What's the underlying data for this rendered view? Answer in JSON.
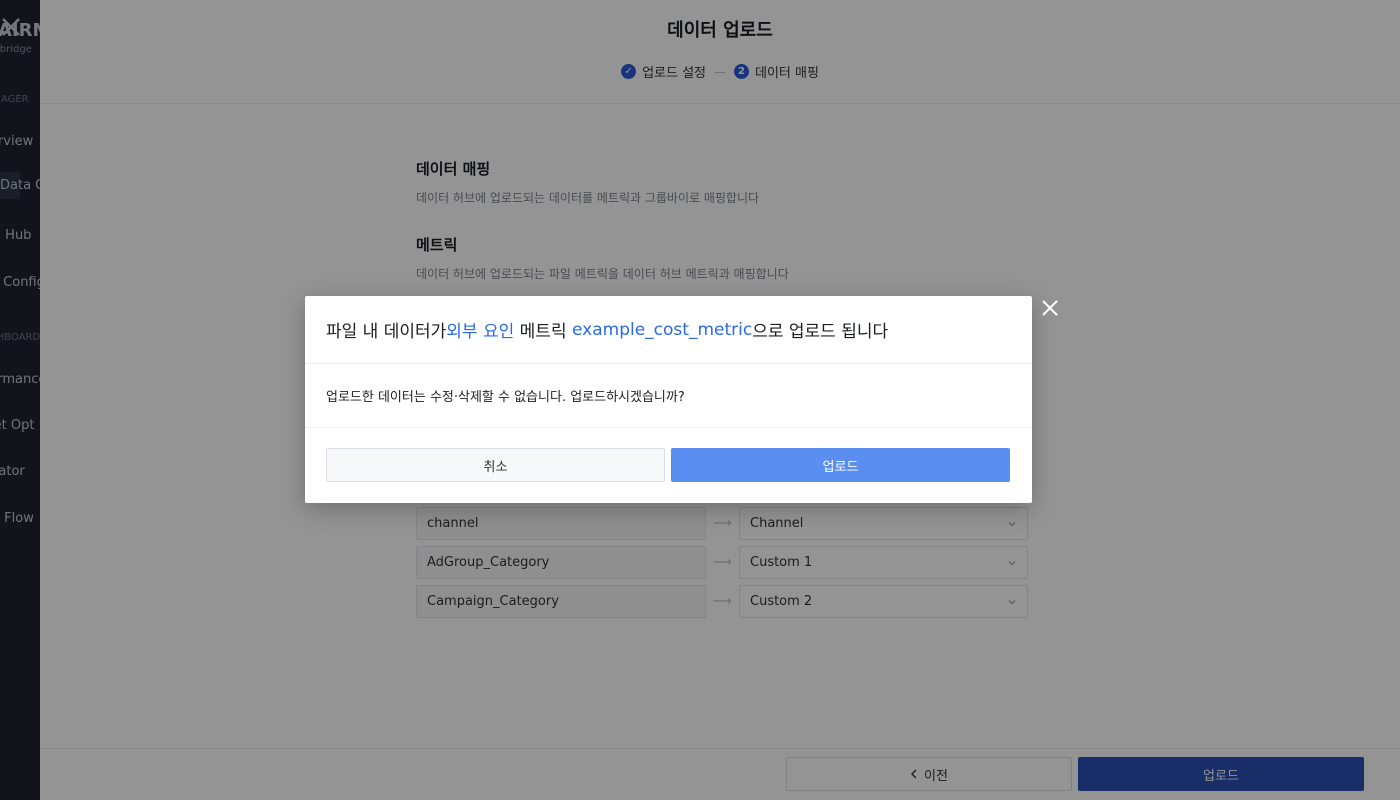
{
  "sidebar": {
    "logo": "AIRM",
    "logo_sub": "Airbridge",
    "section_manager": "MANAGER",
    "section_dashboard": "DASHBOARD",
    "items": [
      {
        "label": "Overview"
      },
      {
        "label": "Data Connect"
      },
      {
        "label": "Data Hub"
      },
      {
        "label": "Model Config"
      },
      {
        "label": "Performance"
      },
      {
        "label": "Budget Opt"
      },
      {
        "label": "Simulator"
      },
      {
        "label": "Insight Flow"
      }
    ]
  },
  "panel": {
    "title": "데이터 업로드",
    "steps": [
      {
        "badge": "✓",
        "label": "업로드 설정"
      },
      {
        "badge": "2",
        "label": "데이터 매핑"
      }
    ],
    "step_separator": "—",
    "mapping_title": "데이터 매핑",
    "mapping_desc": "데이터 허브에 업로드되는 데이터를 메트릭과 그룹바이로 매핑합니다",
    "metric_title": "메트릭",
    "metric_desc": "데이터 허브에 업로드되는 파일 메트릭을 데이터 허브 메트릭과 매핑합니다",
    "rows": [
      {
        "source": "channel",
        "target": "Channel"
      },
      {
        "source": "AdGroup_Category",
        "target": "Custom 1"
      },
      {
        "source": "Campaign_Category",
        "target": "Custom 2"
      }
    ],
    "arrow": "⟶",
    "footer": {
      "prev_label": "이전",
      "upload_label": "업로드"
    }
  },
  "modal": {
    "title_part1": "파일 내 데이터가 ",
    "title_highlight1": "외부 요인",
    "title_part2": " 메트릭 ",
    "title_highlight2": "example_cost_metric",
    "title_part3": "으로 업로드 됩니다",
    "message": "업로드한 데이터는 수정·삭제할 수 없습니다. 업로드하시겠습니까?",
    "cancel_label": "취소",
    "confirm_label": "업로드"
  },
  "colors": {
    "accent": "#2a6ae9",
    "confirm_button": "#5b8ef1",
    "primary_button": "#2b4fb4"
  }
}
